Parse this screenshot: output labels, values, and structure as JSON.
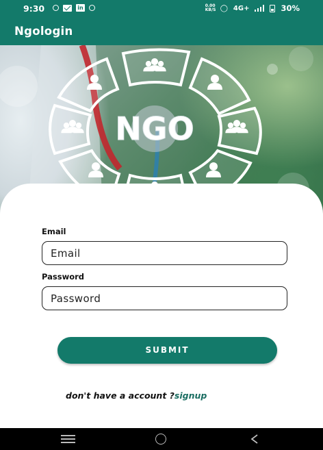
{
  "status_bar": {
    "time": "9:30",
    "network_speed": "0.00 KB/S",
    "network_type": "4G+",
    "battery": "30%"
  },
  "app_bar": {
    "title": "Ngologin"
  },
  "hero": {
    "logo_text": "NGO"
  },
  "form": {
    "email_label": "Email",
    "email_placeholder": "Email",
    "password_label": "Password",
    "password_placeholder": "Password",
    "submit_label": "SUBMIT",
    "signup_prompt": "don't have a account ?",
    "signup_link": "signup"
  },
  "colors": {
    "primary": "#137a6a",
    "link": "#1b6e62"
  },
  "icons": [
    "wifi-icon",
    "mail-icon",
    "linkedin-icon",
    "data-saver-icon",
    "signal-icon",
    "battery-icon",
    "menu-icon",
    "home-icon",
    "back-icon"
  ]
}
